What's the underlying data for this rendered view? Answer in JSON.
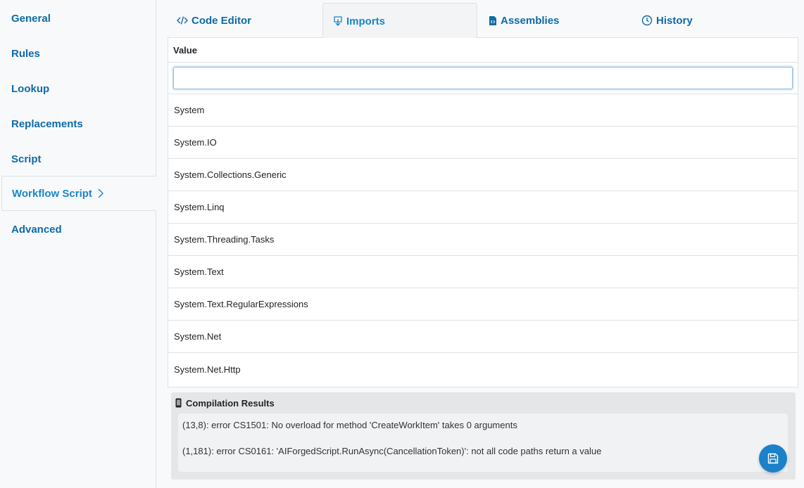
{
  "sidebar": {
    "items": [
      {
        "label": "General"
      },
      {
        "label": "Rules"
      },
      {
        "label": "Lookup"
      },
      {
        "label": "Replacements"
      },
      {
        "label": "Script"
      },
      {
        "label": "Workflow Script",
        "active": true
      },
      {
        "label": "Advanced"
      }
    ]
  },
  "tabs": [
    {
      "label": "Code Editor",
      "icon": "code-icon"
    },
    {
      "label": "Imports",
      "icon": "import-icon",
      "active": true
    },
    {
      "label": "Assemblies",
      "icon": "file-code-icon"
    },
    {
      "label": "History",
      "icon": "clock-icon"
    }
  ],
  "grid": {
    "column_header": "Value",
    "filter_value": "",
    "rows": [
      "System",
      "System.IO",
      "System.Collections.Generic",
      "System.Linq",
      "System.Threading.Tasks",
      "System.Text",
      "System.Text.RegularExpressions",
      "System.Net",
      "System.Net.Http"
    ]
  },
  "compilation": {
    "title": "Compilation Results",
    "messages": [
      "(13,8): error CS1501: No overload for method 'CreateWorkItem' takes 0 arguments",
      "(1,181): error CS0161: 'AIForgedScript.RunAsync(CancellationToken)': not all code paths return a value"
    ]
  },
  "colors": {
    "accent": "#1a86c8",
    "link": "#0f6ba8",
    "save_button": "#1b81c9"
  }
}
